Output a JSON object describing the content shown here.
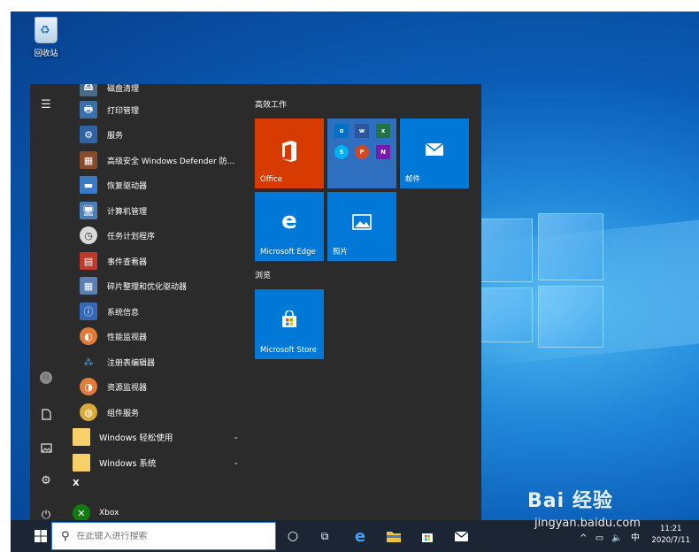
{
  "desktop": {
    "recycle_bin_label": "回收站"
  },
  "colors": {
    "tile_blue": "#0078d7",
    "office_red": "#d83b01",
    "menu_bg": "#2b2b2b",
    "taskbar_bg": "#1b2533"
  },
  "rail": {
    "hamburger_icon": "menu-icon",
    "user_icon": "user-icon",
    "documents_icon": "document-icon",
    "pictures_icon": "pictures-icon",
    "settings_icon": "gear-icon",
    "power_icon": "power-icon"
  },
  "apps": [
    {
      "label": "磁盘清理",
      "icon": "disk-cleanup-icon"
    },
    {
      "label": "打印管理",
      "icon": "print-management-icon"
    },
    {
      "label": "服务",
      "icon": "services-gear-icon"
    },
    {
      "label": "高级安全 Windows Defender 防...",
      "icon": "firewall-icon"
    },
    {
      "label": "恢复驱动器",
      "icon": "recovery-drive-icon"
    },
    {
      "label": "计算机管理",
      "icon": "computer-management-icon"
    },
    {
      "label": "任务计划程序",
      "icon": "task-scheduler-icon"
    },
    {
      "label": "事件查看器",
      "icon": "event-viewer-icon"
    },
    {
      "label": "碎片整理和优化驱动器",
      "icon": "defrag-icon"
    },
    {
      "label": "系统信息",
      "icon": "system-info-icon"
    },
    {
      "label": "性能监视器",
      "icon": "performance-monitor-icon"
    },
    {
      "label": "注册表编辑器",
      "icon": "registry-editor-icon"
    },
    {
      "label": "资源监视器",
      "icon": "resource-monitor-icon"
    },
    {
      "label": "组件服务",
      "icon": "component-services-icon"
    }
  ],
  "folders": [
    {
      "label": "Windows 轻松使用"
    },
    {
      "label": "Windows 系统"
    }
  ],
  "section_letter": "X",
  "xbox": {
    "label": "Xbox"
  },
  "tiles": {
    "group1_title": "高效工作",
    "office_label": "Office",
    "mail_label": "邮件",
    "edge_label": "Microsoft Edge",
    "photos_label": "照片",
    "group2_title": "浏览",
    "store_label": "Microsoft Store"
  },
  "taskbar": {
    "search_placeholder": "在此键入进行搜索",
    "time": "11:21",
    "date": "2020/7/11",
    "ime": "中"
  },
  "watermark": {
    "main": "Bai 经验",
    "sub": "jingyan.baidu.com"
  }
}
